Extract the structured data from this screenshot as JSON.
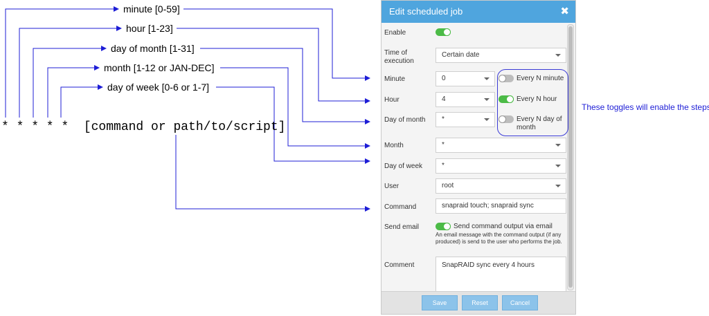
{
  "diagram": {
    "cron_line": "* * * * *  [command or path/to/script]",
    "fields": [
      {
        "label": "minute [0-59]"
      },
      {
        "label": "hour [1-23]"
      },
      {
        "label": "day of month [1-31]"
      },
      {
        "label": "month [1-12 or JAN-DEC]"
      },
      {
        "label": "day of week [0-6 or 1-7]"
      }
    ],
    "note": "These toggles will enable the steps",
    "arrow_color": "#1d1dd6"
  },
  "dialog": {
    "title": "Edit scheduled job",
    "close_symbol": "✖",
    "accent": "#4fa5de",
    "rows": {
      "enable": {
        "label": "Enable",
        "on": true
      },
      "time_of_execution": {
        "label": "Time of execution",
        "value": "Certain date"
      },
      "minute": {
        "label": "Minute",
        "value": "0",
        "toggle_label": "Every N minute",
        "toggle_on": false
      },
      "hour": {
        "label": "Hour",
        "value": "4",
        "toggle_label": "Every N hour",
        "toggle_on": true
      },
      "day_of_month": {
        "label": "Day of month",
        "value": "*",
        "toggle_label": "Every N day of month",
        "toggle_on": false
      },
      "month": {
        "label": "Month",
        "value": "*"
      },
      "day_of_week": {
        "label": "Day of week",
        "value": "*"
      },
      "user": {
        "label": "User",
        "value": "root"
      },
      "command": {
        "label": "Command",
        "value": "snapraid touch; snapraid sync"
      },
      "send_email": {
        "label": "Send email",
        "on": true,
        "toggle_label": "Send command output via email",
        "hint": "An email message with the command output (if any produced) is send to the user who performs the job."
      },
      "comment": {
        "label": "Comment",
        "value": "SnapRAID sync every 4 hours"
      }
    },
    "buttons": {
      "save": "Save",
      "reset": "Reset",
      "cancel": "Cancel"
    }
  }
}
